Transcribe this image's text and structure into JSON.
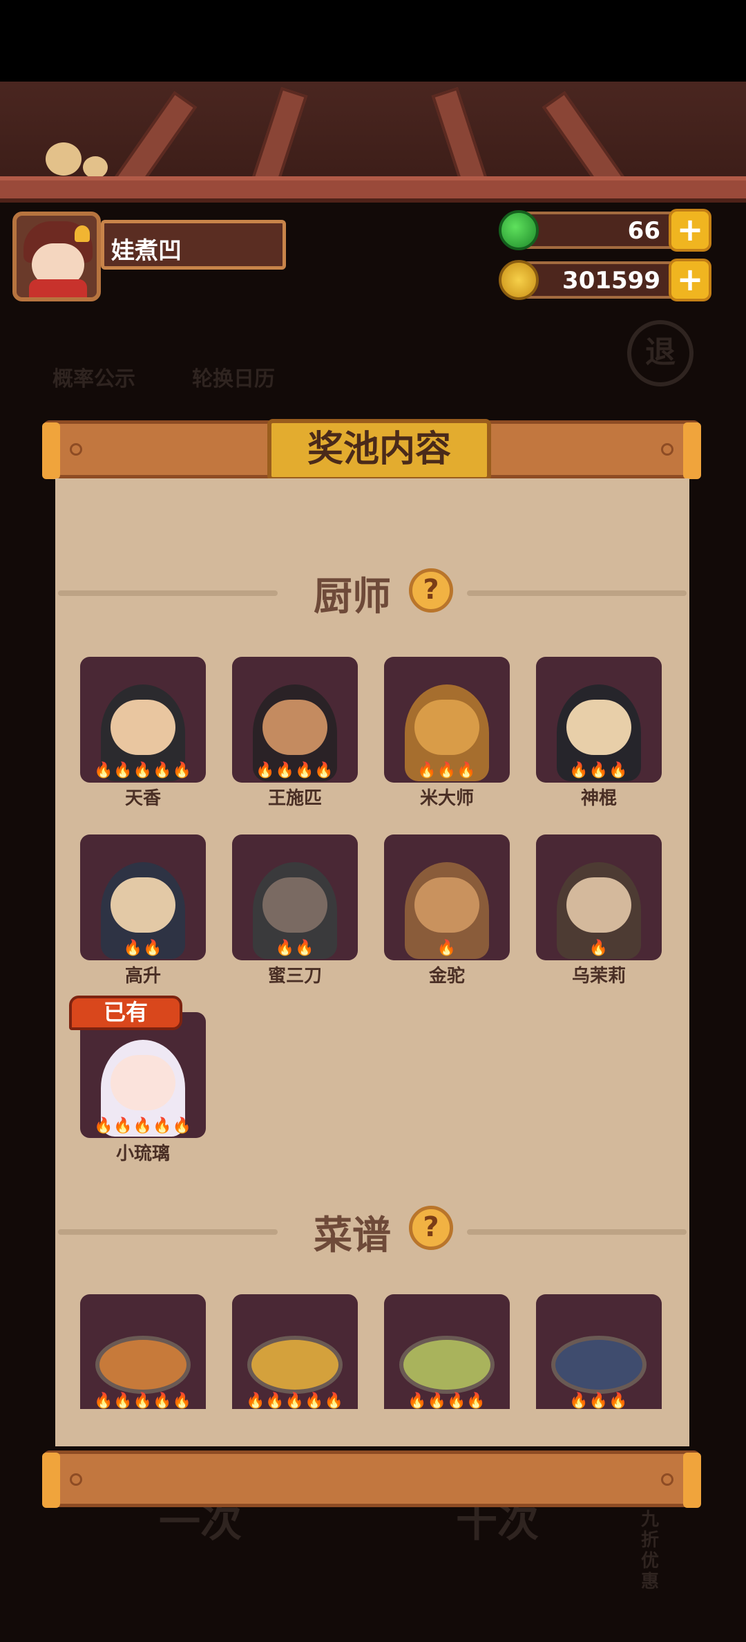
{
  "player": {
    "name": "娃煮凹"
  },
  "resources": {
    "jade": "66",
    "coins": "301599"
  },
  "background": {
    "prob_label": "概率公示",
    "calendar_label": "轮换日历",
    "exit_label": "退",
    "pull_once": "一次",
    "pull_ten": "十次",
    "discount": "九折优惠"
  },
  "modal": {
    "title": "奖池内容"
  },
  "chefs_section": {
    "title": "厨师",
    "help": "?"
  },
  "chefs": [
    {
      "name": "天香",
      "flames": "🔥🔥🔥🔥🔥",
      "bg": "#2b2a2e",
      "skin": "#e9c6a0"
    },
    {
      "name": "王施匹",
      "flames": "🔥🔥🔥🔥",
      "bg": "#2a2226",
      "skin": "#c48b60"
    },
    {
      "name": "米大师",
      "flames": "🔥🔥🔥",
      "bg": "#a66e2e",
      "skin": "#d99c48"
    },
    {
      "name": "神棍",
      "flames": "🔥🔥🔥",
      "bg": "#26252b",
      "skin": "#e8cfa9"
    },
    {
      "name": "高升",
      "flames": "🔥🔥",
      "bg": "#2e3344",
      "skin": "#e3c9a6"
    },
    {
      "name": "蜜三刀",
      "flames": "🔥🔥",
      "bg": "#3a3a3c",
      "skin": "#7a6a62"
    },
    {
      "name": "金驼",
      "flames": "🔥",
      "bg": "#8a5c3a",
      "skin": "#c9925e"
    },
    {
      "name": "乌茉莉",
      "flames": "🔥",
      "bg": "#4d3b33",
      "skin": "#d4b99c"
    },
    {
      "name": "小琉璃",
      "flames": "🔥🔥🔥🔥🔥",
      "bg": "#efe8f4",
      "skin": "#fbe3dc"
    }
  ],
  "owned_badge": "已有",
  "recipes_section": {
    "title": "菜谱",
    "help": "?"
  },
  "recipes": [
    {
      "flames": "🔥🔥🔥🔥🔥",
      "color": "#c77a3a"
    },
    {
      "flames": "🔥🔥🔥🔥🔥",
      "color": "#d4a13c"
    },
    {
      "flames": "🔥🔥🔥🔥",
      "color": "#a9b35c"
    },
    {
      "flames": "🔥🔥🔥",
      "color": "#3f4c6e"
    }
  ],
  "colors": {
    "panel": "#d3b99b",
    "card": "#4a2835",
    "accent": "#e3ac2f"
  }
}
